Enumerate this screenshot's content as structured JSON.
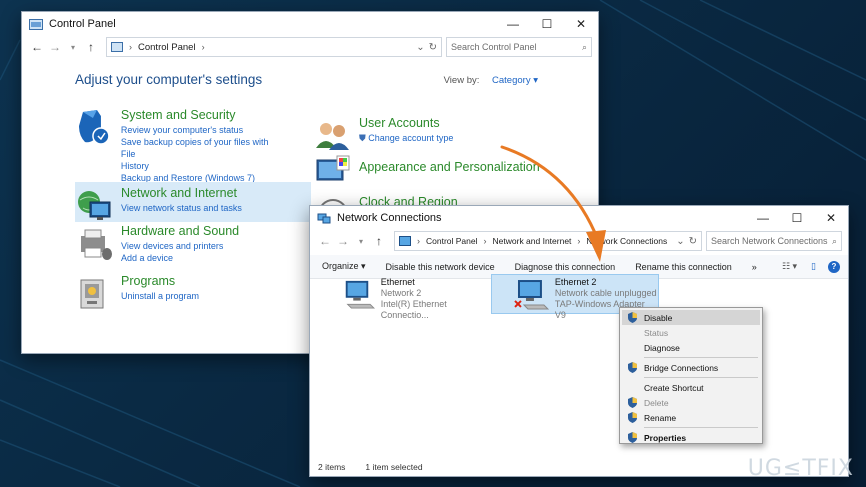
{
  "control_panel": {
    "title": "Control Panel",
    "address": "Control Panel",
    "search_placeholder": "Search Control Panel",
    "heading": "Adjust your computer's settings",
    "view_by_label": "View by:",
    "view_by_value": "Category",
    "categories": [
      {
        "title": "System and Security",
        "links": [
          "Review your computer's status",
          "Save backup copies of your files with File",
          "History",
          "Backup and Restore (Windows 7)"
        ]
      },
      {
        "title": "Network and Internet",
        "links": [
          "View network status and tasks"
        ]
      },
      {
        "title": "Hardware and Sound",
        "links": [
          "View devices and printers",
          "Add a device"
        ]
      },
      {
        "title": "Programs",
        "links": [
          "Uninstall a program"
        ]
      },
      {
        "title": "User Accounts",
        "links": [
          "Change account type"
        ]
      },
      {
        "title": "Appearance and Personalization",
        "links": []
      },
      {
        "title": "Clock and Region",
        "links": []
      }
    ]
  },
  "network_connections": {
    "title": "Network Connections",
    "breadcrumbs": [
      "Control Panel",
      "Network and Internet",
      "Network Connections"
    ],
    "search_placeholder": "Search Network Connections",
    "toolbar": [
      "Organize ▾",
      "Disable this network device",
      "Diagnose this connection",
      "Rename this connection",
      "»"
    ],
    "items": [
      {
        "name": "Ethernet",
        "line2": "Network 2",
        "line3": "Intel(R) Ethernet Connectio..."
      },
      {
        "name": "Ethernet 2",
        "line2": "Network cable unplugged",
        "line3": "TAP-Windows Adapter V9"
      }
    ],
    "status_count": "2 items",
    "status_selected": "1 item selected"
  },
  "context_menu": {
    "items": [
      {
        "label": "Disable"
      },
      {
        "label": "Status"
      },
      {
        "label": "Diagnose"
      },
      {
        "label": "Bridge Connections"
      },
      {
        "label": "Create Shortcut"
      },
      {
        "label": "Delete"
      },
      {
        "label": "Rename"
      },
      {
        "label": "Properties"
      }
    ]
  },
  "watermark": "UG≤TFIX",
  "colors": {
    "link": "#1f66c5",
    "category_title": "#2b8a2b",
    "accent_arrow": "#e87a24"
  }
}
